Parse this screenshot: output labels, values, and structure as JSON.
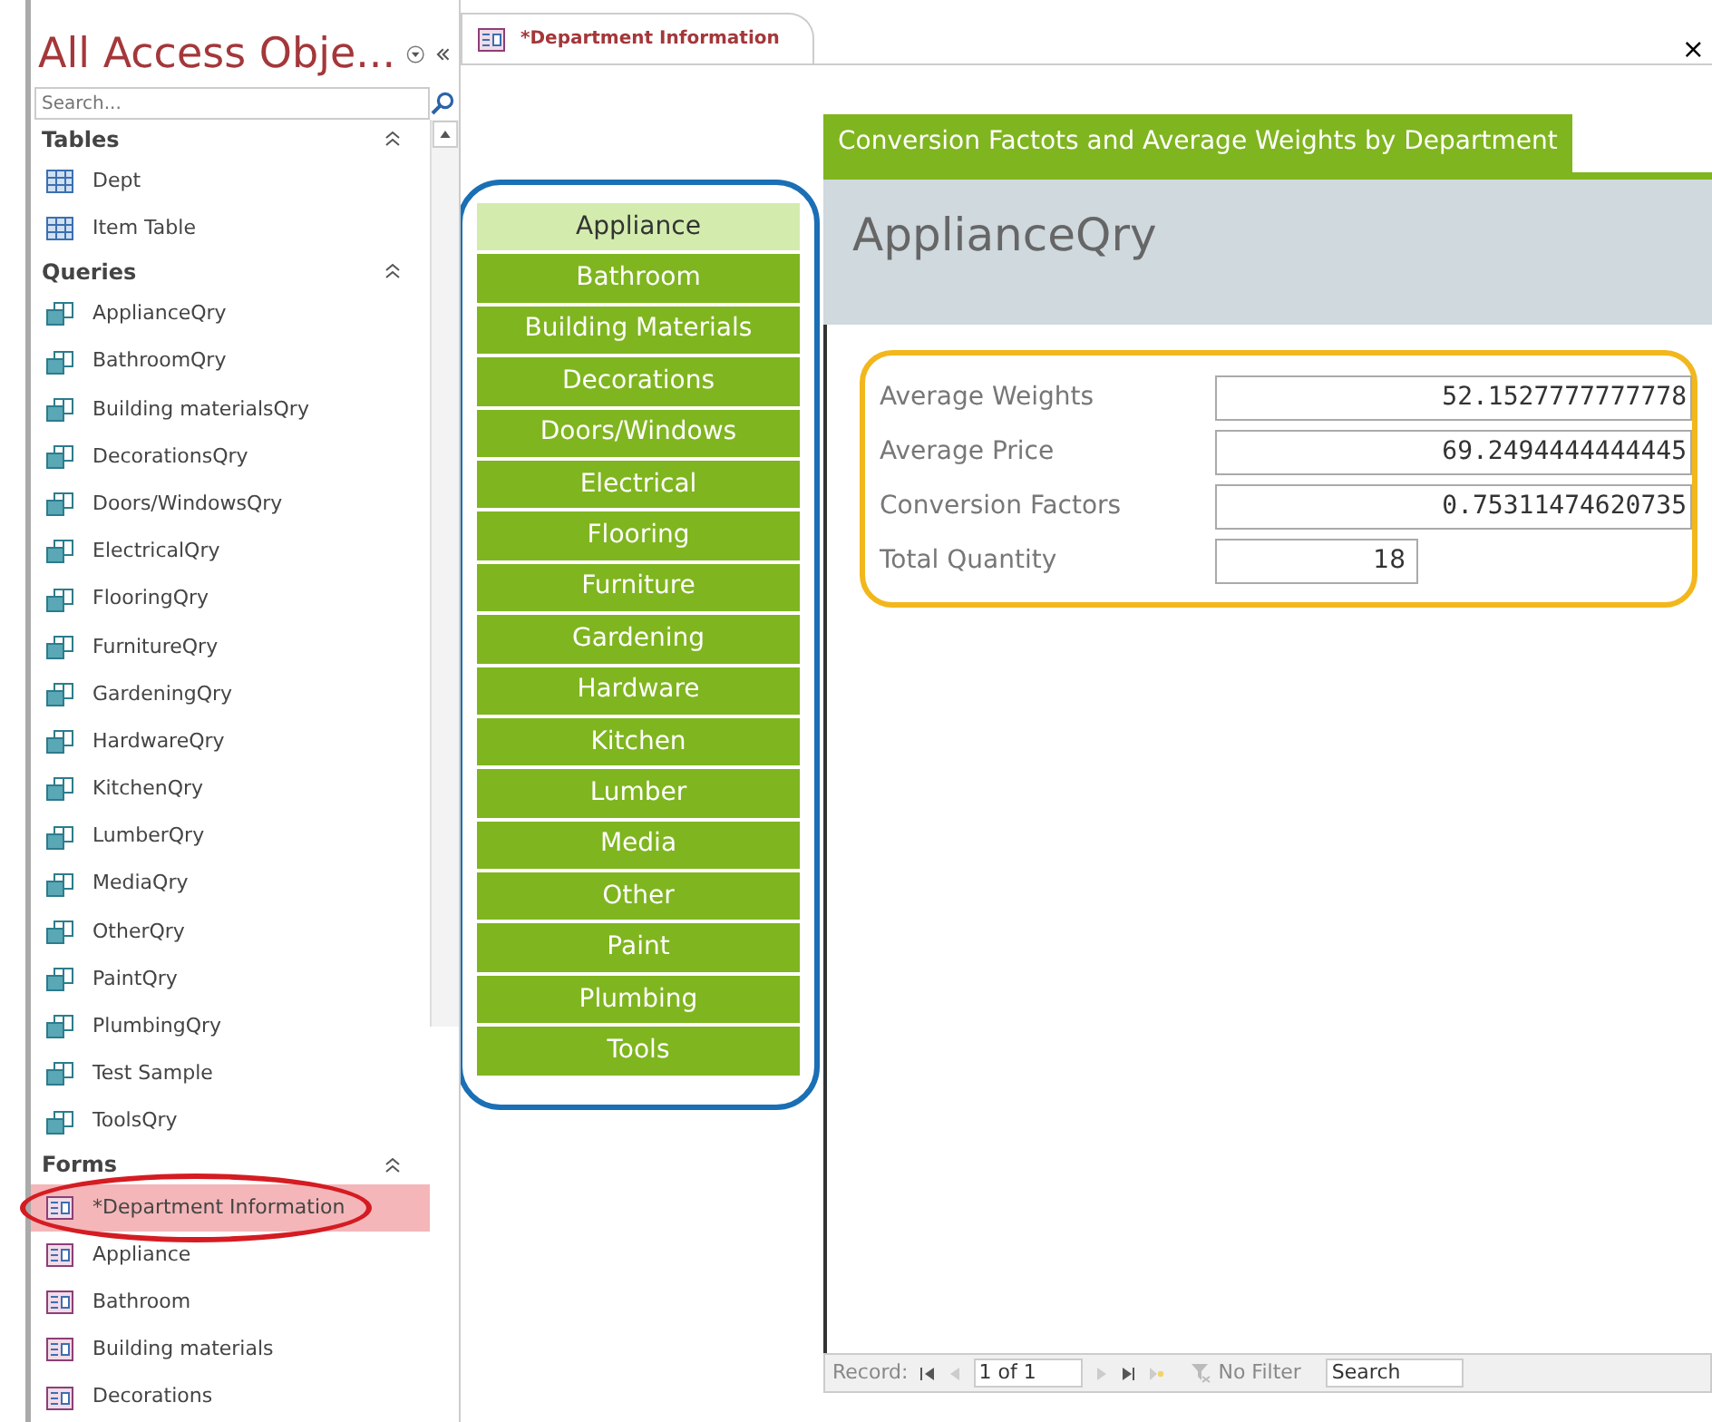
{
  "nav_pane": {
    "title": "All Access Obje...",
    "search": {
      "placeholder": "Search..."
    },
    "groups": [
      {
        "label": "Tables",
        "kind": "table",
        "items": [
          {
            "label": "Dept",
            "selected": false
          },
          {
            "label": "Item Table",
            "selected": false
          }
        ]
      },
      {
        "label": "Queries",
        "kind": "query",
        "items": [
          {
            "label": "ApplianceQry",
            "selected": false
          },
          {
            "label": "BathroomQry",
            "selected": false
          },
          {
            "label": "Building materialsQry",
            "selected": false
          },
          {
            "label": "DecorationsQry",
            "selected": false
          },
          {
            "label": "Doors/WindowsQry",
            "selected": false
          },
          {
            "label": "ElectricalQry",
            "selected": false
          },
          {
            "label": "FlooringQry",
            "selected": false
          },
          {
            "label": "FurnitureQry",
            "selected": false
          },
          {
            "label": "GardeningQry",
            "selected": false
          },
          {
            "label": "HardwareQry",
            "selected": false
          },
          {
            "label": "KitchenQry",
            "selected": false
          },
          {
            "label": "LumberQry",
            "selected": false
          },
          {
            "label": "MediaQry",
            "selected": false
          },
          {
            "label": "OtherQry",
            "selected": false
          },
          {
            "label": "PaintQry",
            "selected": false
          },
          {
            "label": "PlumbingQry",
            "selected": false
          },
          {
            "label": "Test Sample",
            "selected": false
          },
          {
            "label": "ToolsQry",
            "selected": false
          }
        ]
      },
      {
        "label": "Forms",
        "kind": "form",
        "items": [
          {
            "label": "*Department Information",
            "selected": true
          },
          {
            "label": "Appliance",
            "selected": false
          },
          {
            "label": "Bathroom",
            "selected": false
          },
          {
            "label": "Building materials",
            "selected": false
          },
          {
            "label": "Decorations",
            "selected": false
          }
        ]
      }
    ]
  },
  "document_tab": {
    "title": "*Department Information",
    "close": "×"
  },
  "form": {
    "header_tab": "Conversion Factots and Average Weights by Department",
    "departments": [
      {
        "label": "Appliance",
        "selected": true
      },
      {
        "label": "Bathroom",
        "selected": false
      },
      {
        "label": "Building Materials",
        "selected": false
      },
      {
        "label": "Decorations",
        "selected": false
      },
      {
        "label": "Doors/Windows",
        "selected": false
      },
      {
        "label": "Electrical",
        "selected": false
      },
      {
        "label": "Flooring",
        "selected": false
      },
      {
        "label": "Furniture",
        "selected": false
      },
      {
        "label": "Gardening",
        "selected": false
      },
      {
        "label": "Hardware",
        "selected": false
      },
      {
        "label": "Kitchen",
        "selected": false
      },
      {
        "label": "Lumber",
        "selected": false
      },
      {
        "label": "Media",
        "selected": false
      },
      {
        "label": "Other",
        "selected": false
      },
      {
        "label": "Paint",
        "selected": false
      },
      {
        "label": "Plumbing",
        "selected": false
      },
      {
        "label": "Tools",
        "selected": false
      }
    ],
    "subform_title": "ApplianceQry",
    "fields": [
      {
        "label": "Average Weights",
        "value": "52.1527777777778",
        "kind": "wide"
      },
      {
        "label": "Average Price",
        "value": "69.2494444444445",
        "kind": "wide"
      },
      {
        "label": "Conversion Factors",
        "value": "0.75311474620735",
        "kind": "wide"
      },
      {
        "label": "Total Quantity",
        "value": "18",
        "kind": "narrow"
      }
    ]
  },
  "record_bar": {
    "label": "Record:",
    "position": "1 of 1",
    "filter": "No Filter",
    "search": "Search"
  }
}
